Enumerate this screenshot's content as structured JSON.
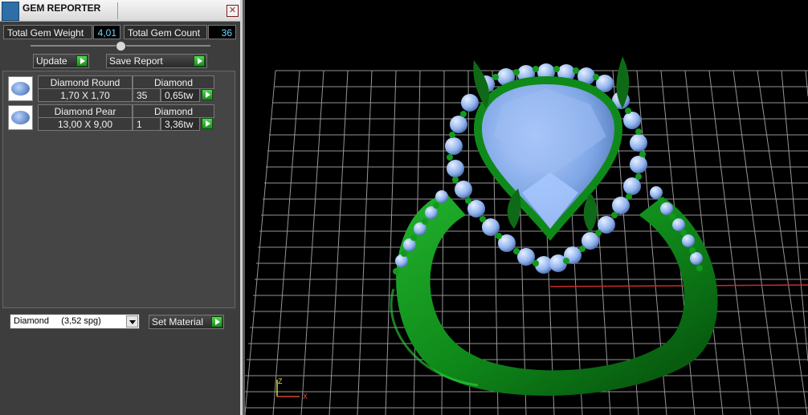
{
  "panel": {
    "title": "GEM REPORTER",
    "close_glyph": "✕",
    "totals": {
      "weight_label": "Total Gem Weight",
      "weight_value": "4,01",
      "count_label": "Total Gem Count",
      "count_value": "36"
    },
    "toolbar": {
      "update_label": "Update",
      "save_label": "Save Report"
    },
    "gems": [
      {
        "name": "Diamond Round",
        "material": "Diamond",
        "size": "1,70 X 1,70",
        "count": "35",
        "weight": "0,65tw",
        "icon": "round-gem-icon"
      },
      {
        "name": "Diamond Pear",
        "material": "Diamond",
        "size": "13,00 X 9,00",
        "count": "1",
        "weight": "3,36tw",
        "icon": "pear-gem-icon"
      }
    ],
    "material_select": {
      "selected": "Diamond     (3,52 spg)"
    },
    "set_material_label": "Set Material"
  },
  "viewport": {
    "axis_z": "Z",
    "axis_x": "X",
    "colors": {
      "metal": "#0f8a1a",
      "stone": "#7fa6e6",
      "grid": "#b0b0b0",
      "x_axis": "#cc2b2b"
    }
  }
}
